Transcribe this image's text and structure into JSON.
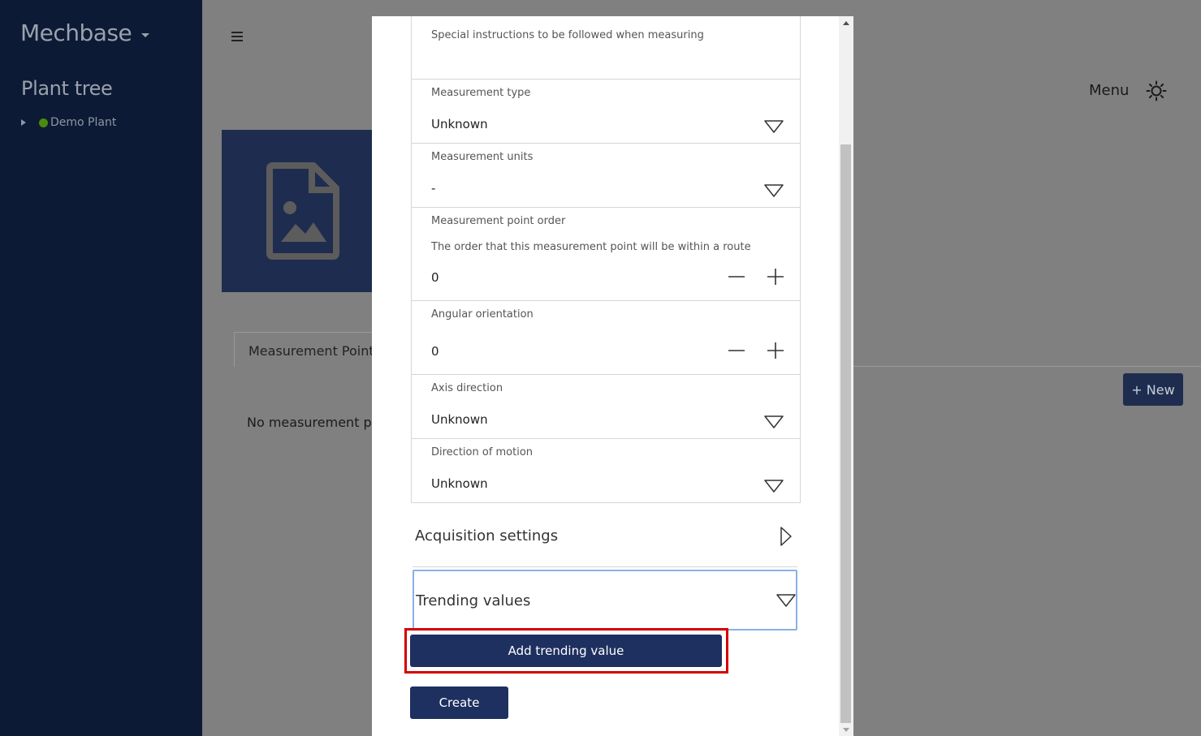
{
  "sidebar": {
    "brand": "Mechbase",
    "tree_title": "Plant tree",
    "tree_items": [
      {
        "label": "Demo Plant",
        "status_color": "#4c8a0e"
      }
    ]
  },
  "header": {
    "menu_label": "Menu"
  },
  "main": {
    "tab_label": "Measurement Points",
    "empty_message": "No measurement poi",
    "new_button_label": "+ New"
  },
  "modal": {
    "special_instructions_desc": "Special instructions to be followed when measuring",
    "measurement_type": {
      "label": "Measurement type",
      "value": "Unknown"
    },
    "measurement_units": {
      "label": "Measurement units",
      "value": "-"
    },
    "measurement_point_order": {
      "label": "Measurement point order",
      "description": "The order that this measurement point will be within a route",
      "value": "0"
    },
    "angular_orientation": {
      "label": "Angular orientation",
      "value": "0"
    },
    "axis_direction": {
      "label": "Axis direction",
      "value": "Unknown"
    },
    "direction_of_motion": {
      "label": "Direction of motion",
      "value": "Unknown"
    },
    "acquisition_settings": "Acquisition settings",
    "trending_values": "Trending values",
    "add_trending_value_label": "Add trending value",
    "create_label": "Create"
  },
  "colors": {
    "sidebar_bg": "#0d1a35",
    "primary_button": "#1e3060",
    "highlight": "#d40000",
    "focus_border": "#8ab0e8"
  }
}
